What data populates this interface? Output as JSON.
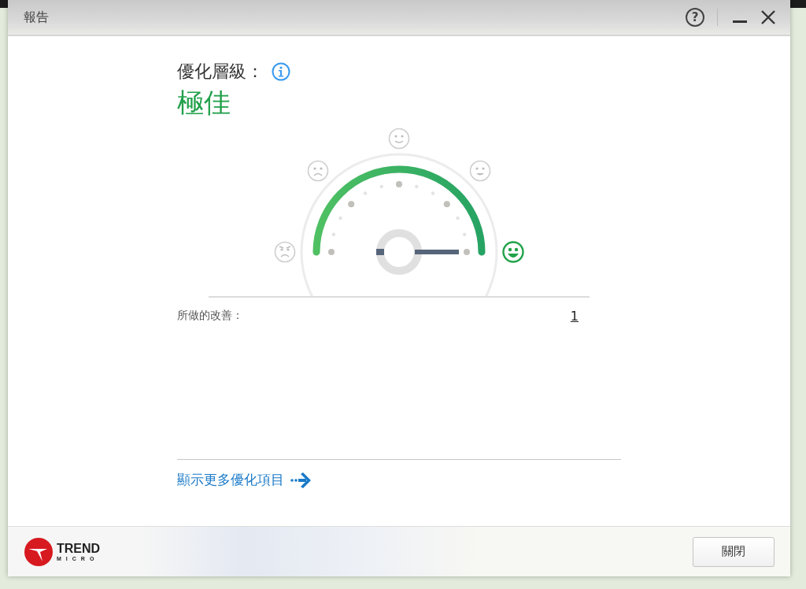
{
  "window": {
    "title": "報告",
    "help_button": "?"
  },
  "rating": {
    "label": "優化層級：",
    "value": "極佳"
  },
  "gauge": {
    "level": 1,
    "faces": [
      {
        "kind": "angry",
        "selected": false
      },
      {
        "kind": "sad",
        "selected": false
      },
      {
        "kind": "neutral",
        "selected": false
      },
      {
        "kind": "happy",
        "selected": false
      },
      {
        "kind": "grinning",
        "selected": true
      }
    ]
  },
  "improvements": {
    "label": "所做的改善：",
    "count": "1"
  },
  "more_link": "顯示更多優化項目",
  "footer": {
    "logo_top": "TREND",
    "logo_bottom": "MICRO",
    "close_button": "關閉"
  }
}
